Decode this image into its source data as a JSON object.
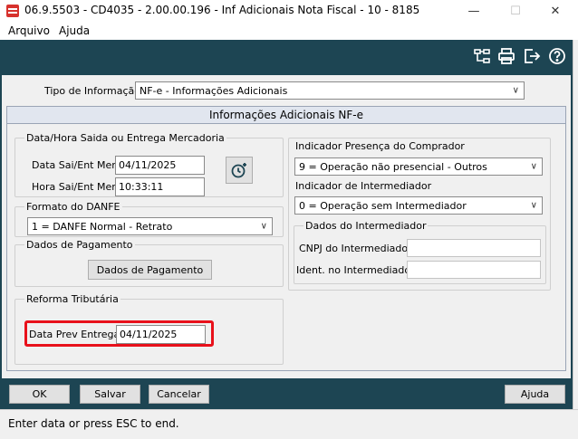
{
  "window": {
    "title": "06.9.5503 - CD4035 - 2.00.00.196 - Inf Adicionais Nota Fiscal - 10 - 8185",
    "minimize": "—",
    "maximize": "☐",
    "close": "✕"
  },
  "menu": {
    "items": [
      "Arquivo",
      "Ajuda"
    ]
  },
  "toolbar": {
    "icons": [
      "tree-structure-icon",
      "print-icon",
      "exit-icon",
      "help-icon"
    ]
  },
  "tipo": {
    "label": "Tipo de Informação:",
    "value": "NF-e - Informações Adicionais"
  },
  "section": {
    "title": "Informações Adicionais NF-e"
  },
  "datahora": {
    "group_title": "Data/Hora Saida ou Entrega Mercadoria",
    "data_label": "Data Sai/Ent Merc:",
    "data_value": "04/11/2025",
    "hora_label": "Hora Sai/Ent Merc:",
    "hora_value": "10:33:11"
  },
  "danfe": {
    "group_title": "Formato do DANFE",
    "value": "1 = DANFE Normal - Retrato"
  },
  "pagamento": {
    "group_title": "Dados de Pagamento",
    "button_label": "Dados de Pagamento"
  },
  "reforma": {
    "group_title": "Reforma Tributária",
    "label": "Data Prev Entrega:",
    "value": "04/11/2025"
  },
  "presenca": {
    "label": "Indicador Presença do Comprador",
    "value": "9 = Operação não presencial - Outros"
  },
  "intermediador": {
    "label": "Indicador de Intermediador",
    "value": "0 = Operação sem Intermediador",
    "group_title": "Dados do Intermediador",
    "cnpj_label": "CNPJ do Intermediador:",
    "cnpj_value": "",
    "ident_label": "Ident. no Intermediador:",
    "ident_value": ""
  },
  "buttons": {
    "ok": "OK",
    "salvar": "Salvar",
    "cancelar": "Cancelar",
    "ajuda": "Ajuda"
  },
  "status": {
    "text": "Enter data or press ESC to end."
  },
  "colors": {
    "toolbar": "#1d4553",
    "highlight": "#e8111b",
    "panel": "#f0f0f0"
  }
}
